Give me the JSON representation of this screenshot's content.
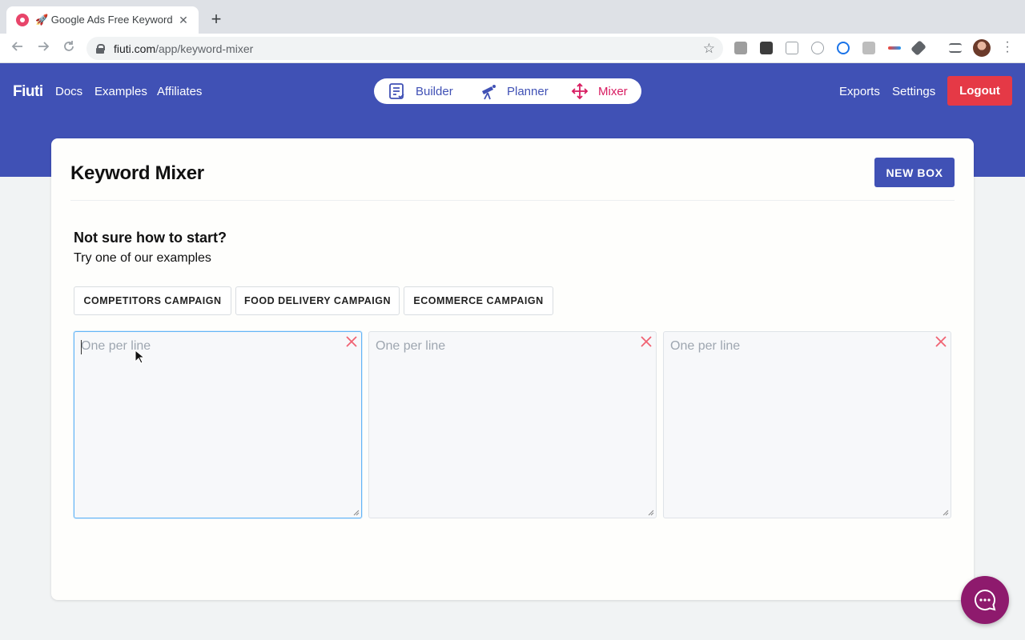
{
  "browser": {
    "tab_title": "🚀 Google Ads Free Keyword M",
    "tab_close": "✕",
    "new_tab": "+",
    "url_host": "fiuti.com",
    "url_path": "/app/keyword-mixer"
  },
  "header": {
    "brand": "Fiuti",
    "nav_left": [
      "Docs",
      "Examples",
      "Affiliates"
    ],
    "pill_items": [
      {
        "label": "Builder",
        "icon": "list-check-icon"
      },
      {
        "label": "Planner",
        "icon": "telescope-icon"
      },
      {
        "label": "Mixer",
        "icon": "move-arrows-icon"
      }
    ],
    "active_pill": "Mixer",
    "nav_right": [
      "Exports",
      "Settings"
    ],
    "logout_label": "Logout"
  },
  "main": {
    "title": "Keyword Mixer",
    "new_box_label": "NEW BOX",
    "help_title": "Not sure how to start?",
    "help_subtitle": "Try one of our examples",
    "examples": [
      "COMPETITORS CAMPAIGN",
      "FOOD DELIVERY CAMPAIGN",
      "ECOMMERCE CAMPAIGN"
    ],
    "boxes": [
      {
        "placeholder": "One per line",
        "value": "",
        "focused": true
      },
      {
        "placeholder": "One per line",
        "value": "",
        "focused": false
      },
      {
        "placeholder": "One per line",
        "value": "",
        "focused": false
      }
    ]
  },
  "colors": {
    "header_bg": "#4051b5",
    "accent_pink": "#d81b60",
    "logout_red": "#e53946",
    "close_red": "#f06272",
    "chat_purple": "#8e1a6d"
  }
}
